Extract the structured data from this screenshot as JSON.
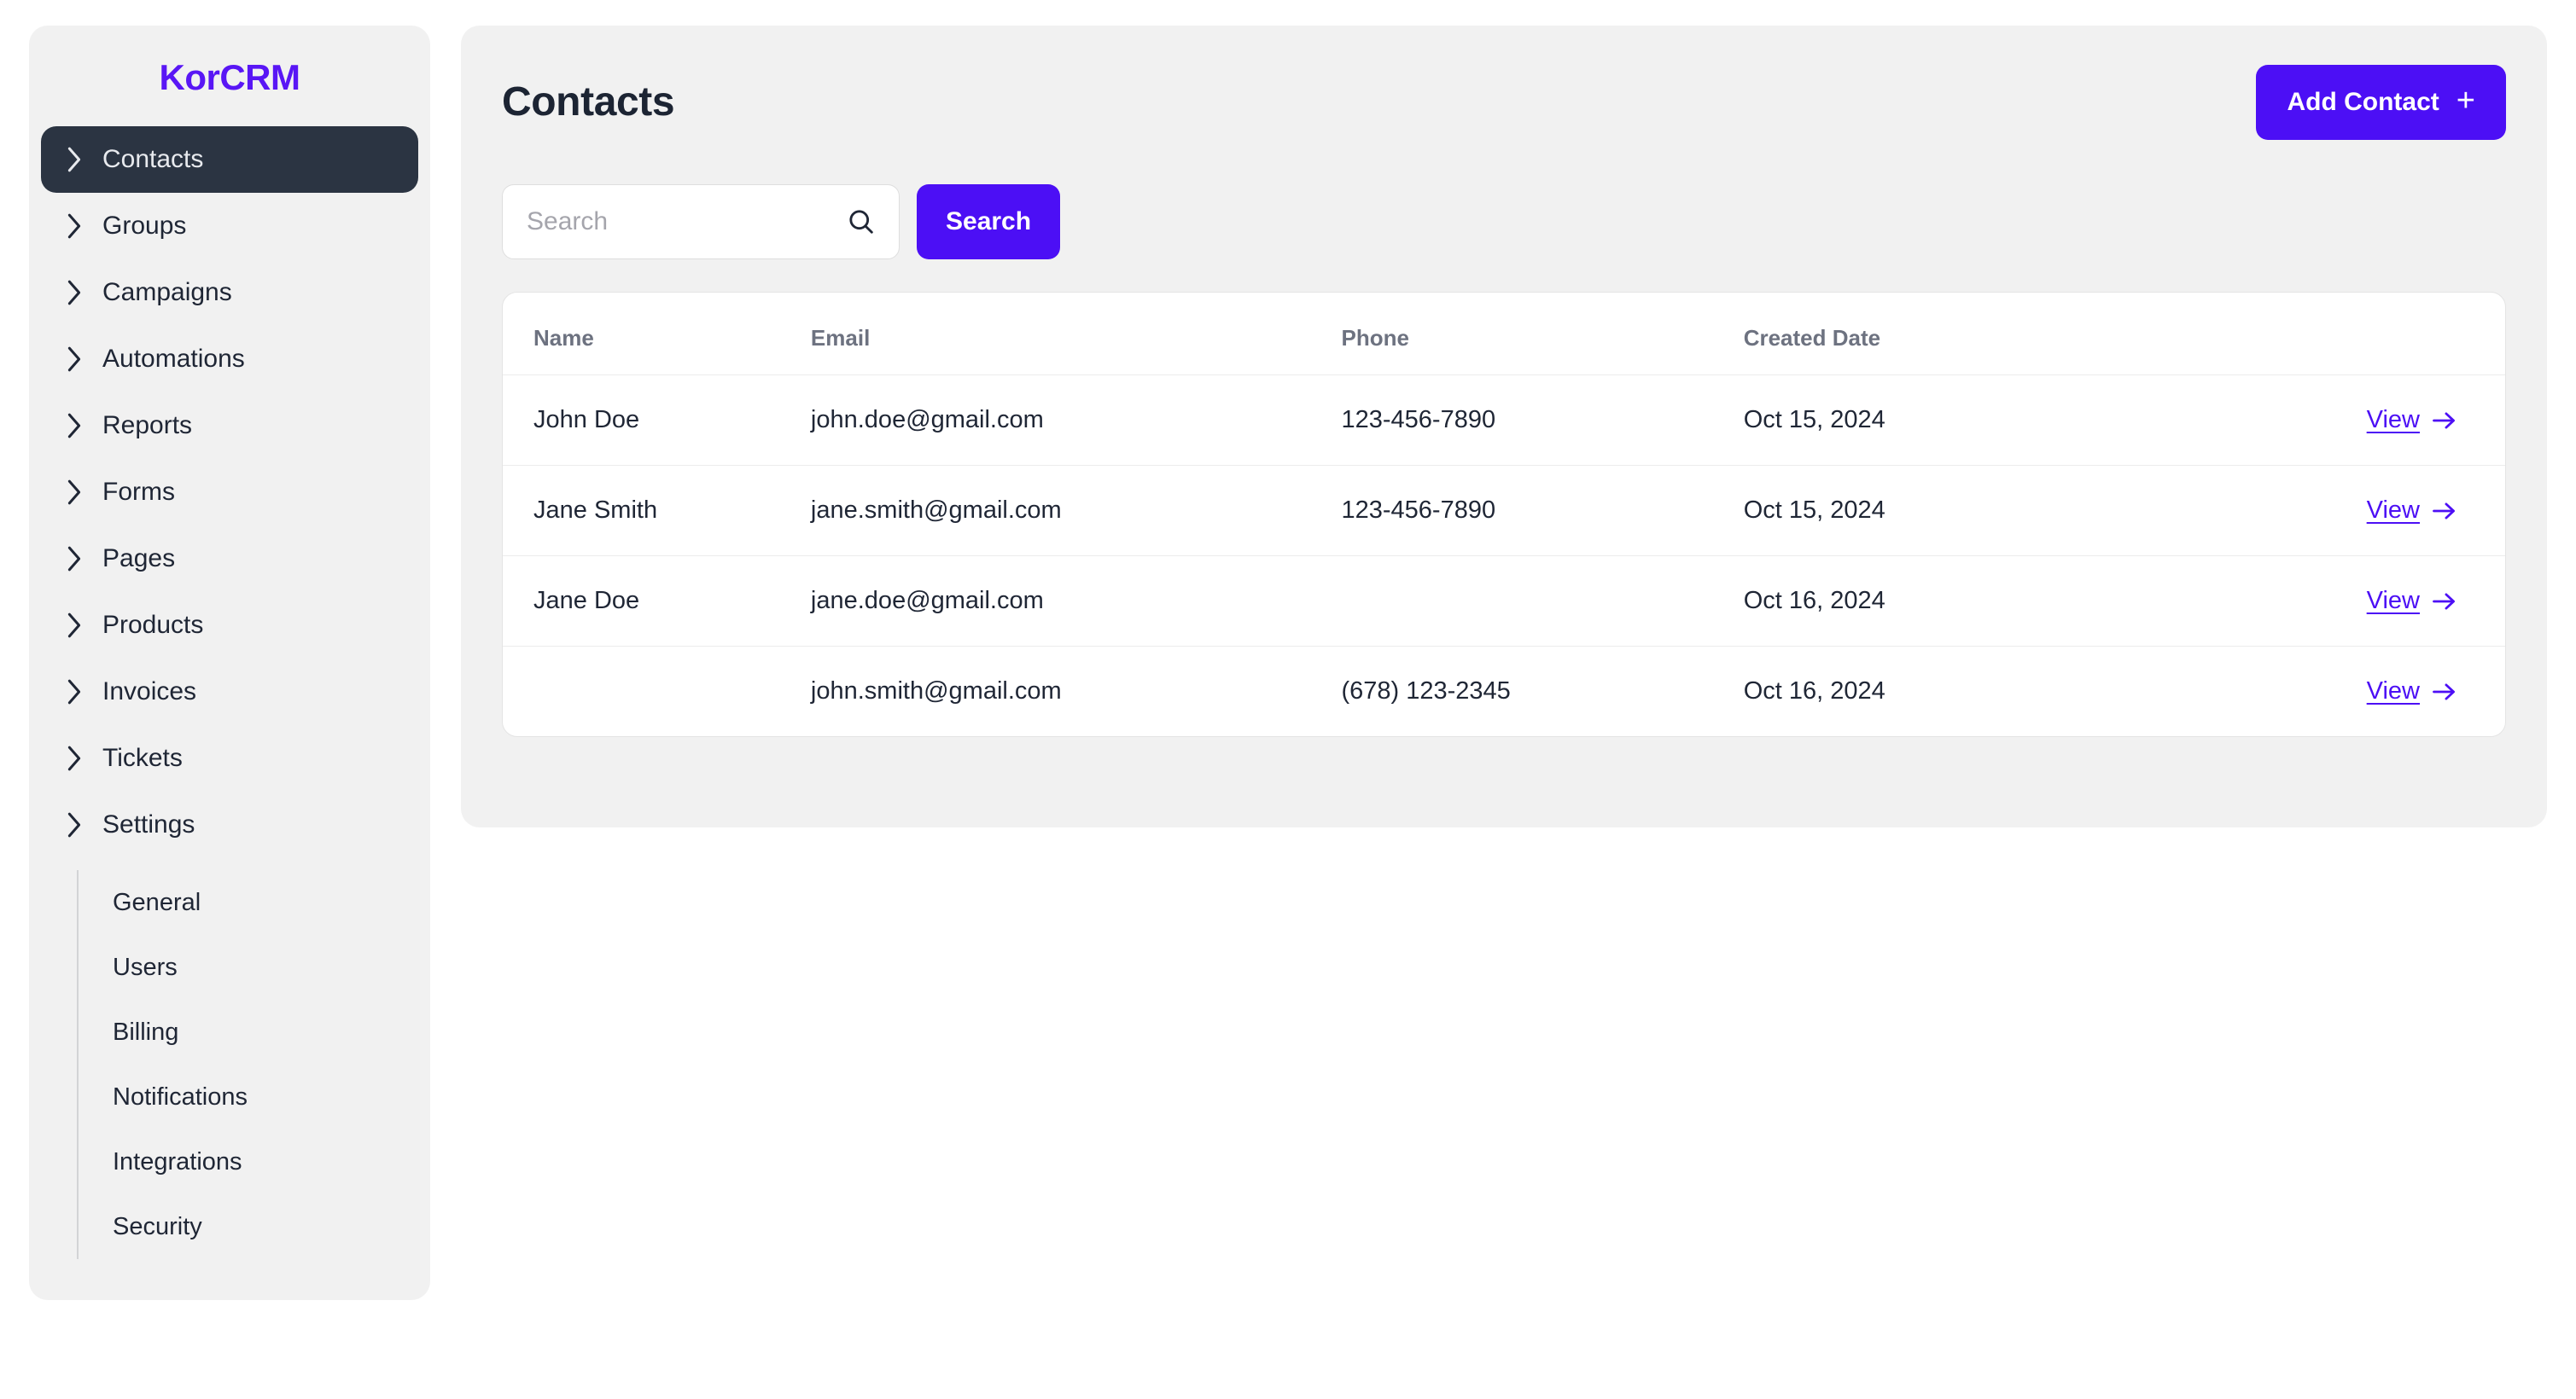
{
  "sidebar": {
    "brand": "KorCRM",
    "items": [
      {
        "label": "Contacts",
        "icon": "chevron-right-icon",
        "active": true
      },
      {
        "label": "Groups",
        "icon": "chevron-right-icon",
        "active": false
      },
      {
        "label": "Campaigns",
        "icon": "chevron-right-icon",
        "active": false
      },
      {
        "label": "Automations",
        "icon": "chevron-right-icon",
        "active": false
      },
      {
        "label": "Reports",
        "icon": "chevron-right-icon",
        "active": false
      },
      {
        "label": "Forms",
        "icon": "chevron-right-icon",
        "active": false
      },
      {
        "label": "Pages",
        "icon": "chevron-right-icon",
        "active": false
      },
      {
        "label": "Products",
        "icon": "chevron-right-icon",
        "active": false
      },
      {
        "label": "Invoices",
        "icon": "chevron-right-icon",
        "active": false
      },
      {
        "label": "Tickets",
        "icon": "chevron-right-icon",
        "active": false
      },
      {
        "label": "Settings",
        "icon": "chevron-right-icon",
        "active": false
      }
    ],
    "settings_children": [
      {
        "label": "General"
      },
      {
        "label": "Users"
      },
      {
        "label": "Billing"
      },
      {
        "label": "Notifications"
      },
      {
        "label": "Integrations"
      },
      {
        "label": "Security"
      }
    ]
  },
  "main": {
    "page_title": "Contacts",
    "add_contact_label": "Add Contact",
    "add_contact_icon": "plus-icon",
    "search": {
      "placeholder": "Search",
      "value": "",
      "icon": "search-icon",
      "button_label": "Search"
    },
    "table": {
      "columns": [
        "Name",
        "Email",
        "Phone",
        "Created Date"
      ],
      "action_label": "View",
      "action_icon": "arrow-right-icon",
      "rows": [
        {
          "name": "John Doe",
          "email": "john.doe@gmail.com",
          "phone": "123-456-7890",
          "created_date": "Oct 15, 2024",
          "action": "View"
        },
        {
          "name": "Jane Smith",
          "email": "jane.smith@gmail.com",
          "phone": "123-456-7890",
          "created_date": "Oct 15, 2024",
          "action": "View"
        },
        {
          "name": "Jane Doe",
          "email": "jane.doe@gmail.com",
          "phone": "",
          "created_date": "Oct 16, 2024",
          "action": "View"
        },
        {
          "name": "",
          "email": "john.smith@gmail.com",
          "phone": "(678) 123-2345",
          "created_date": "Oct 16, 2024",
          "action": "View"
        }
      ]
    }
  },
  "colors": {
    "brand_purple": "#5916f5",
    "accent_purple": "#4c0ff5",
    "active_nav_bg": "#2b3442",
    "panel_bg": "#f1f1f1",
    "card_bg": "#ffffff",
    "text_dark": "#1f2635",
    "text_muted": "#6d7280"
  }
}
